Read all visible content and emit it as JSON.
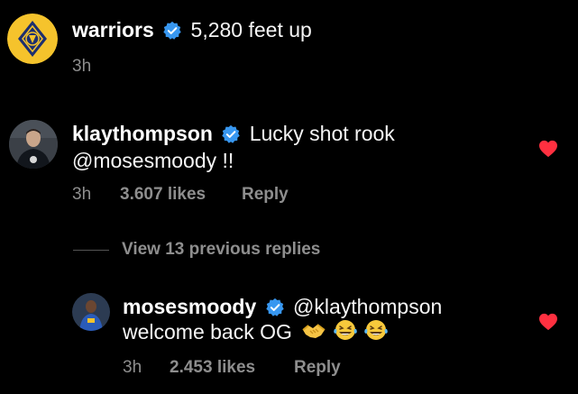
{
  "caption": {
    "username": "warriors",
    "text": "5,280 feet up",
    "time": "3h"
  },
  "comment": {
    "username": "klaythompson",
    "text_line1": "Lucky shot rook",
    "text_line2": "@mosesmoody !!",
    "time": "3h",
    "likes": "3.607 likes",
    "reply_label": "Reply",
    "liked": true
  },
  "view_replies": {
    "label": "View 13 previous replies"
  },
  "reply": {
    "username": "mosesmoody",
    "mention": "@klaythompson",
    "text_line2": "welcome back OG",
    "emojis": [
      "handshake-emoji",
      "laughing-tears-emoji",
      "laughing-tears-emoji"
    ],
    "time": "3h",
    "likes": "2.453 likes",
    "reply_label": "Reply",
    "liked": true
  },
  "colors": {
    "background": "#000000",
    "verified": "#3897f0",
    "heart": "#ff3040",
    "meta_text": "#8e8e8e",
    "warriors_gold": "#f5c32c",
    "warriors_navy": "#1d2f6f"
  }
}
